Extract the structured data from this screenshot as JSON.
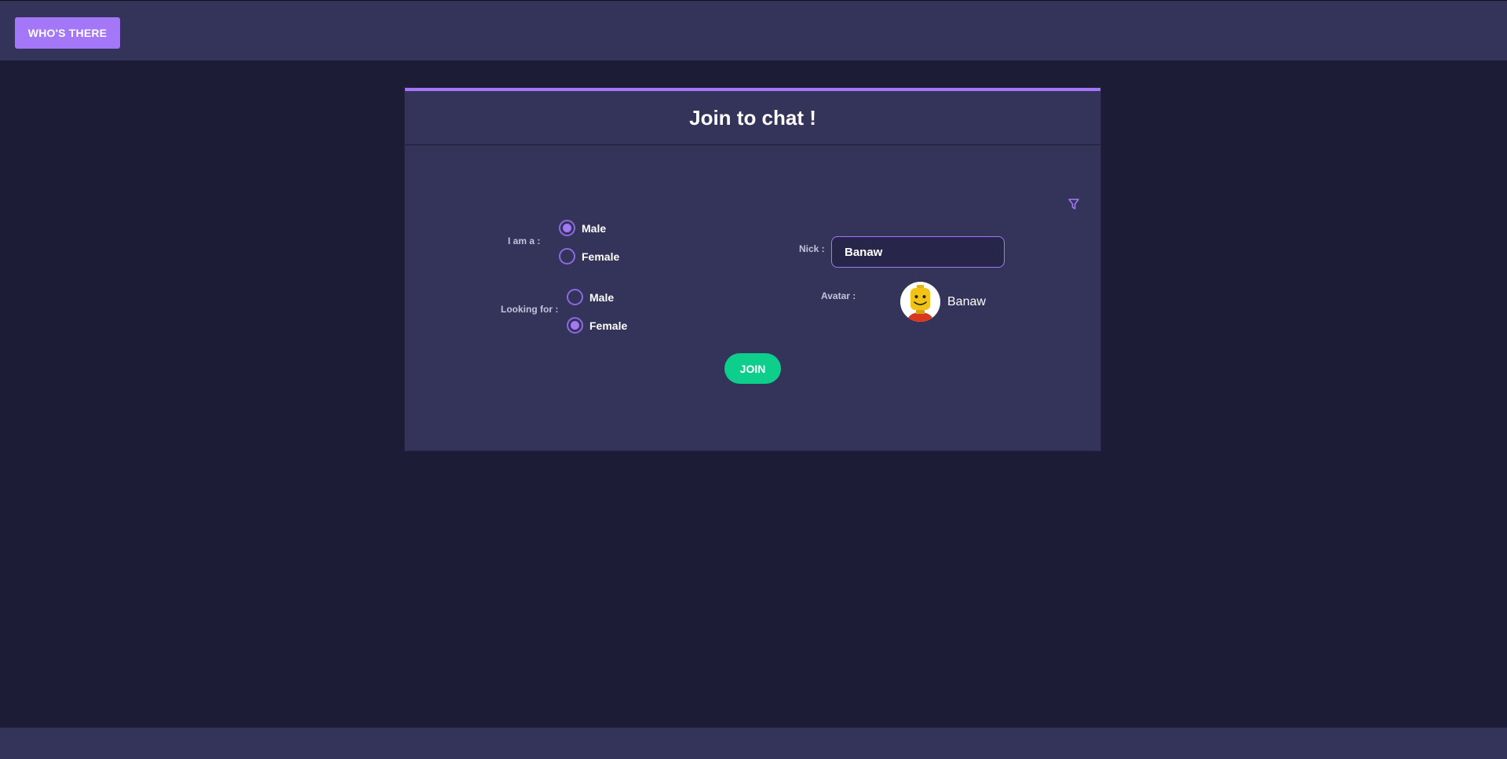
{
  "header": {
    "brand_button": "WHO'S THERE"
  },
  "card": {
    "title": "Join to chat !",
    "filter_icon": "filter-icon"
  },
  "form": {
    "gender_label": "I am a :",
    "gender_options": [
      {
        "label": "Male",
        "selected": true
      },
      {
        "label": "Female",
        "selected": false
      }
    ],
    "looking_label": "Looking for :",
    "looking_options": [
      {
        "label": "Male",
        "selected": false
      },
      {
        "label": "Female",
        "selected": true
      }
    ],
    "nick_label": "Nick :",
    "nick_value": "Banaw",
    "avatar_label": "Avatar :",
    "avatar_name": "Banaw",
    "join_button": "JOIN"
  },
  "colors": {
    "background": "#1c1c37",
    "panel": "#34335a",
    "accent": "#a377f7",
    "join": "#0dce8b"
  }
}
